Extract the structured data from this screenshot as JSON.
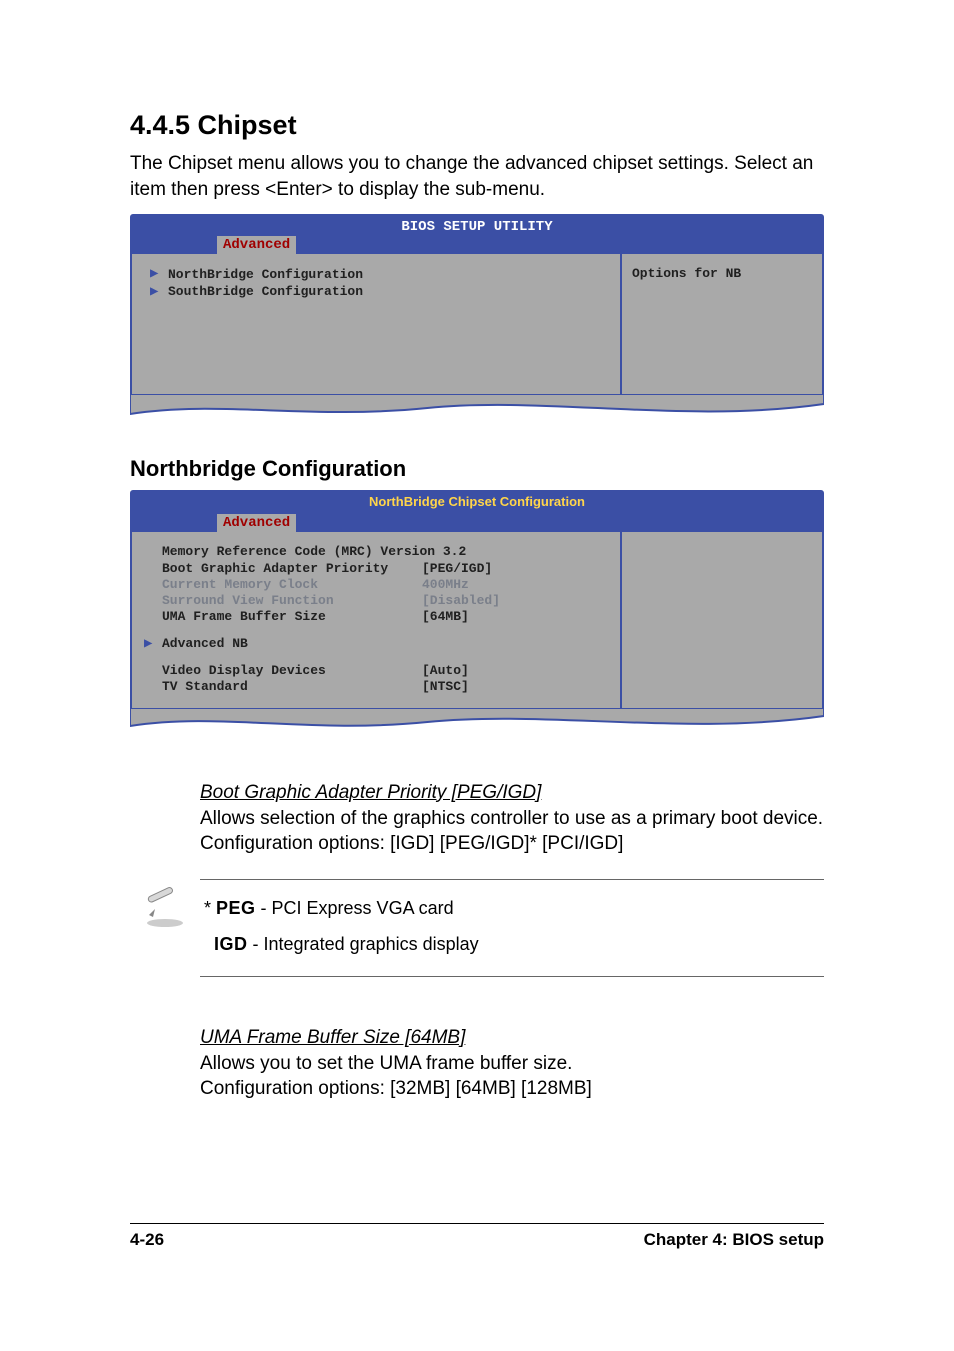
{
  "heading": "4.4.5   Chipset",
  "intro": "The Chipset menu allows you to change the advanced chipset settings. Select an item then press <Enter> to display the sub-menu.",
  "bios1": {
    "title": "BIOS SETUP UTILITY",
    "tab": "Advanced",
    "menu_items": [
      "NorthBridge Configuration",
      "SouthBridge Configuration"
    ],
    "help": "Options for NB"
  },
  "sub_heading": "Northbridge Configuration",
  "bios2": {
    "subtitle": "NorthBridge Chipset Configuration",
    "tab": "Advanced",
    "info_line": "Memory Reference Code (MRC) Version 3.2",
    "items": [
      {
        "label": "Boot Graphic Adapter Priority",
        "value": "[PEG/IGD]",
        "dim": false
      },
      {
        "label": "Current Memory Clock",
        "value": "400MHz",
        "dim": true
      },
      {
        "label": "Surround View Function",
        "value": "[Disabled]",
        "dim": true
      },
      {
        "label": "UMA Frame Buffer Size",
        "value": "[64MB]",
        "dim": false
      }
    ],
    "submenu": "Advanced NB",
    "items2": [
      {
        "label": "Video Display Devices",
        "value": "[Auto]"
      },
      {
        "label": "TV Standard",
        "value": "[NTSC]"
      }
    ]
  },
  "opt1": {
    "title": "Boot Graphic Adapter Priority [PEG/IGD]",
    "line1": "Allows selection of the graphics controller to use as a primary boot device. Configuration options: [IGD] [PEG/IGD]* [PCI/IGD]"
  },
  "note": {
    "peg_label": "PEG",
    "peg_text": " - PCI Express VGA card",
    "igd_label": "IGD",
    "igd_text": " - Integrated graphics display",
    "prefix": "* "
  },
  "opt2": {
    "title": "UMA Frame Buffer Size [64MB]",
    "line1": "Allows you to set the UMA frame buffer size.",
    "line2": "Configuration options: [32MB] [64MB] [128MB]"
  },
  "footer": {
    "left": "4-26",
    "right": "Chapter 4: BIOS setup"
  }
}
